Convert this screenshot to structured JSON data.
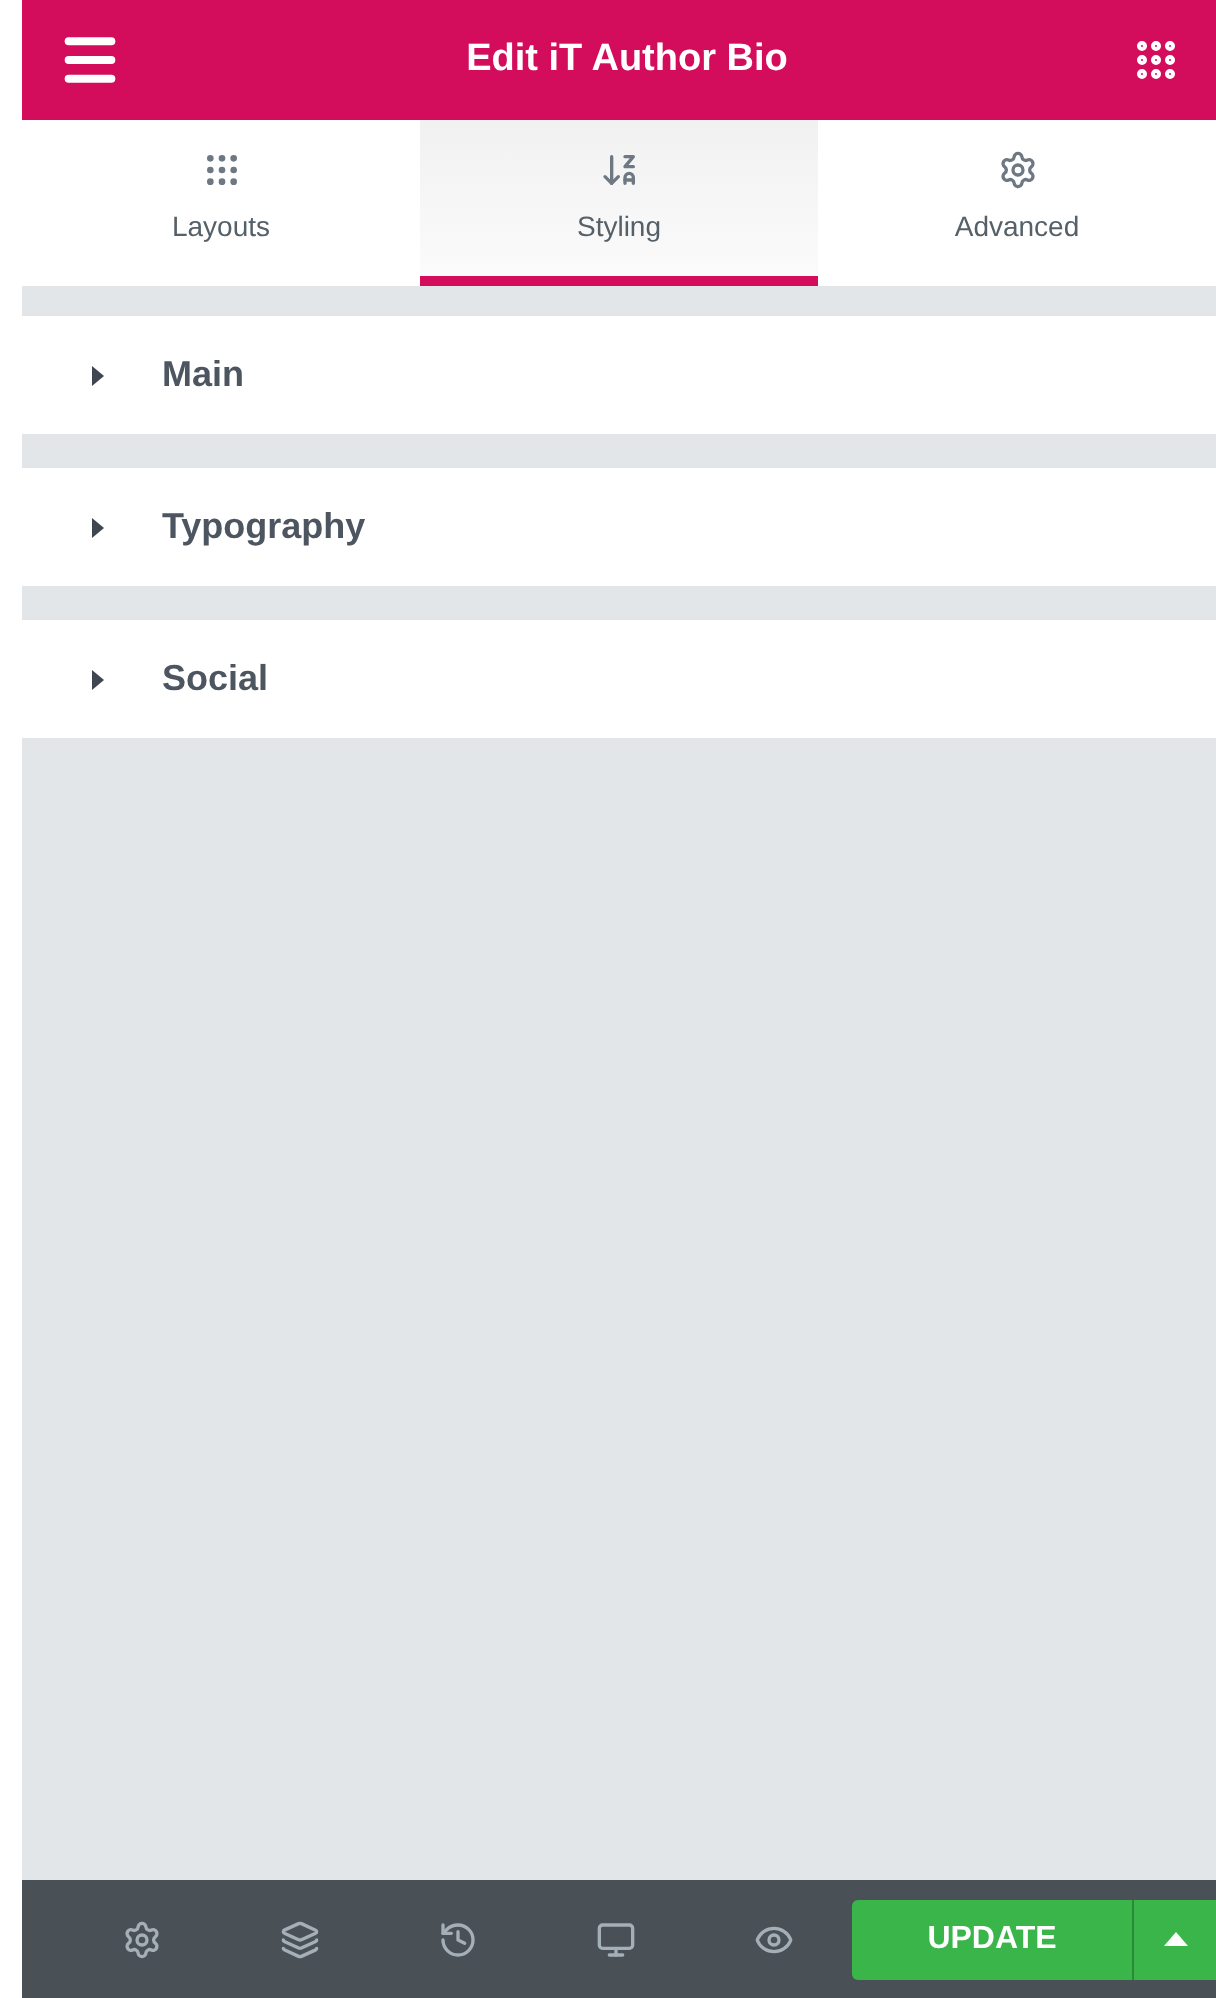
{
  "header": {
    "title": "Edit iT Author Bio"
  },
  "tabs": [
    {
      "label": "Layouts",
      "kind": "grid",
      "selected": false
    },
    {
      "label": "Styling",
      "kind": "sort",
      "selected": true
    },
    {
      "label": "Advanced",
      "kind": "gear",
      "selected": false
    }
  ],
  "sections": [
    {
      "label": "Main",
      "expanded": false
    },
    {
      "label": "Typography",
      "expanded": false
    },
    {
      "label": "Social",
      "expanded": false
    }
  ],
  "footer": {
    "tools": [
      {
        "kind": "settings"
      },
      {
        "kind": "layers"
      },
      {
        "kind": "history"
      },
      {
        "kind": "desktop"
      },
      {
        "kind": "preview"
      }
    ],
    "update_button": "UPDATE"
  }
}
